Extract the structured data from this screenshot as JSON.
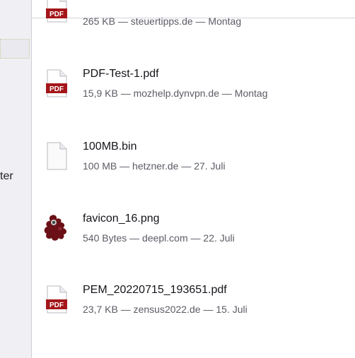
{
  "sidebar": {
    "partial_label": "ter"
  },
  "downloads": [
    {
      "name": "",
      "meta": "265 KB — steuertipps.de — Montag",
      "icon": "pdf-file-icon",
      "icon_label": "PDF"
    },
    {
      "name": "PDF-Test-1.pdf",
      "meta": "15,9 KB — mozhelp.dynvpn.de — Montag",
      "icon": "pdf-file-icon",
      "icon_label": "PDF"
    },
    {
      "name": "100MB.bin",
      "meta": "100 MB — hetzner.de — 27. Juli",
      "icon": "generic-file-icon"
    },
    {
      "name": "favicon_16.png",
      "meta": "540 Bytes — deepl.com — 22. Juli",
      "icon": "image-file-icon"
    },
    {
      "name": "PEM_20220715_193651.pdf",
      "meta": "23,7 KB — zensus2022.de — 15. Juli",
      "icon": "pdf-file-icon",
      "icon_label": "PDF"
    }
  ],
  "colors": {
    "pdf_red": "#a4161a",
    "sidebar_bg": "#f0f0f4",
    "meta_text": "#5b5b66"
  }
}
